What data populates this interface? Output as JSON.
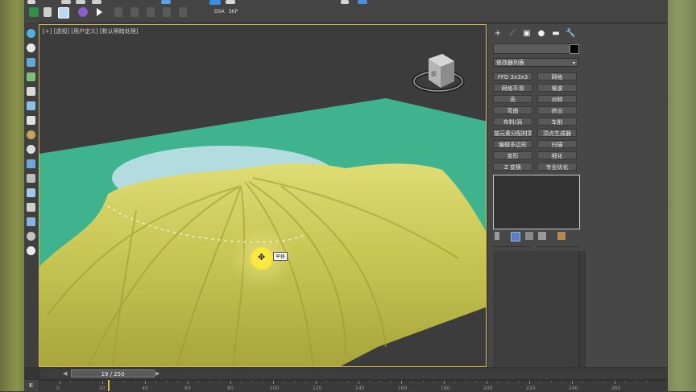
{
  "colors": {
    "viewport_border": "#d8b84a",
    "ground": "#3eb38d",
    "cloth": "#c9c855",
    "table_top": "#b2dce0",
    "cursor_highlight": "#ffe600"
  },
  "toolbar": {
    "items": [
      {
        "name": "undo-icon",
        "color": "#d8d8d8"
      },
      {
        "name": "select-link-icon",
        "color": "#cfcfcf"
      },
      {
        "name": "unlink-icon",
        "color": "#cfcfcf"
      },
      {
        "name": "bind-space-warp-icon",
        "color": "#cfcfcf"
      },
      {
        "name": "select-object-icon",
        "color": "#5fa0e6"
      },
      {
        "name": "select-region-icon",
        "color": "#5fa0e6"
      },
      {
        "name": "select-move-icon",
        "color": "#d6d6d6"
      },
      {
        "name": "select-rotate-icon",
        "color": "#3a8fe0"
      },
      {
        "name": "select-scale-icon",
        "color": "#d6d6d6"
      },
      {
        "name": "snap-toggle-icon",
        "color": "#d6d6d6"
      },
      {
        "name": "angle-snap-icon",
        "color": "#4d8fd8"
      },
      {
        "name": "percent-snap-icon",
        "color": "#d6d6d6"
      }
    ],
    "row2": [
      {
        "name": "scene-explorer-icon",
        "color": "#3a9b4f"
      },
      {
        "name": "tools-icon",
        "color": "#d6d6d6"
      },
      {
        "name": "viewport-layout-icon",
        "color": "#cfe3ff"
      },
      {
        "name": "render-icon",
        "color": "#8b5ec9"
      },
      {
        "name": "play-icon",
        "color": "#ffffff"
      }
    ],
    "labels": {
      "dsa": "DSA",
      "skp": "SKP"
    }
  },
  "viewport": {
    "label": "[+] [透视] [用户定义] [默认明暗处理]",
    "tooltip": "平移",
    "viewcube_label": "前"
  },
  "panel": {
    "tabs": [
      "+",
      "⟋",
      "▣",
      "●",
      "▬",
      "🔧"
    ],
    "modifier_list": "修改器列表",
    "buttons": [
      [
        "FFD 3x3x3",
        "网格"
      ],
      [
        "网格平滑",
        "噪波"
      ],
      [
        "壳",
        "对称"
      ],
      [
        "弯曲",
        "挤出"
      ],
      [
        "布料/涡",
        "车削"
      ],
      [
        "按元素分配材质",
        "顶点生成器"
      ],
      [
        "编辑多边形",
        "扫描"
      ],
      [
        "变形",
        "细化"
      ],
      [
        "Z 变换",
        "专业优化"
      ]
    ]
  },
  "timeline": {
    "frame": "19 / 250",
    "ticks": [
      "0",
      "20",
      "40",
      "60",
      "80",
      "100",
      "120",
      "140",
      "160",
      "180",
      "200",
      "220",
      "240",
      "260"
    ]
  }
}
